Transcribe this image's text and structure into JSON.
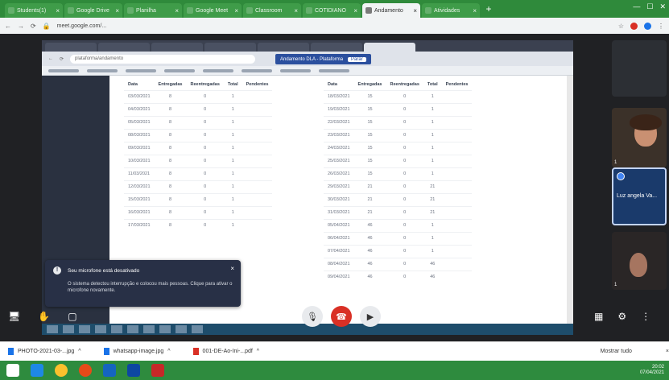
{
  "colors": {
    "chrome_green": "#2f8a3b",
    "meet_bg": "#202124",
    "end_call_red": "#d93025",
    "toast_bg": "#283046"
  },
  "outer_browser": {
    "tabs": [
      {
        "label": "Students(1)",
        "icon": "tab-favicon"
      },
      {
        "label": "Google Drive",
        "icon": "tab-favicon"
      },
      {
        "label": "Planilha",
        "icon": "tab-favicon"
      },
      {
        "label": "Google Meet",
        "icon": "tab-favicon"
      },
      {
        "label": "Classroom",
        "icon": "tab-favicon"
      },
      {
        "label": "COTIDIANO",
        "icon": "tab-favicon"
      },
      {
        "label": "Andamento",
        "icon": "tab-favicon",
        "active": true
      },
      {
        "label": "Atividades",
        "icon": "tab-favicon"
      }
    ],
    "url": "meet.google.com/..."
  },
  "shared_screen": {
    "share_banner": "Andamento DLA - Plataforma",
    "stop_label": "Parar",
    "url": "plataforma/andamento",
    "table_headers": [
      "Data",
      "Entregadas",
      "Reentregadas",
      "Total",
      "Pendentes"
    ],
    "table_left": [
      [
        "03/03/2021",
        "8",
        "0",
        "1",
        ""
      ],
      [
        "04/03/2021",
        "8",
        "0",
        "1",
        ""
      ],
      [
        "05/03/2021",
        "8",
        "0",
        "1",
        ""
      ],
      [
        "08/03/2021",
        "8",
        "0",
        "1",
        ""
      ],
      [
        "09/03/2021",
        "8",
        "0",
        "1",
        ""
      ],
      [
        "10/03/2021",
        "8",
        "0",
        "1",
        ""
      ],
      [
        "11/03/2021",
        "8",
        "0",
        "1",
        ""
      ],
      [
        "12/03/2021",
        "8",
        "0",
        "1",
        ""
      ],
      [
        "15/03/2021",
        "8",
        "0",
        "1",
        ""
      ],
      [
        "16/03/2021",
        "8",
        "0",
        "1",
        ""
      ],
      [
        "17/03/2021",
        "8",
        "0",
        "1",
        ""
      ]
    ],
    "table_right": [
      [
        "18/03/2021",
        "15",
        "0",
        "1",
        ""
      ],
      [
        "19/03/2021",
        "15",
        "0",
        "1",
        ""
      ],
      [
        "22/03/2021",
        "15",
        "0",
        "1",
        ""
      ],
      [
        "23/03/2021",
        "15",
        "0",
        "1",
        ""
      ],
      [
        "24/03/2021",
        "15",
        "0",
        "1",
        ""
      ],
      [
        "25/03/2021",
        "15",
        "0",
        "1",
        ""
      ],
      [
        "26/03/2021",
        "15",
        "0",
        "1",
        ""
      ],
      [
        "29/03/2021",
        "21",
        "0",
        "21",
        ""
      ],
      [
        "30/03/2021",
        "21",
        "0",
        "21",
        ""
      ],
      [
        "31/03/2021",
        "21",
        "0",
        "21",
        ""
      ],
      [
        "05/04/2021",
        "46",
        "0",
        "1",
        ""
      ],
      [
        "06/04/2021",
        "46",
        "0",
        "1",
        ""
      ],
      [
        "07/04/2021",
        "46",
        "0",
        "1",
        ""
      ],
      [
        "08/04/2021",
        "46",
        "0",
        "46",
        ""
      ],
      [
        "09/04/2021",
        "46",
        "0",
        "46",
        ""
      ]
    ]
  },
  "participants": [
    {
      "name": "",
      "role": "blank"
    },
    {
      "name": "",
      "role": "camera"
    },
    {
      "name": "Luz angela Va...",
      "role": "presenter"
    },
    {
      "name": "",
      "role": "camera"
    }
  ],
  "toast": {
    "title": "Seu microfone está desativado",
    "body": "O sistema detectou interrupção e colocou mais pessoas. Clique para ativar o microfone novamente."
  },
  "downloads": [
    {
      "label": "PHOTO-2021-03-...jpg",
      "icon": "image-file-icon"
    },
    {
      "label": "whatsapp-image.jpg",
      "icon": "image-file-icon"
    },
    {
      "label": "001-DE-Ao-Ini-...pdf",
      "icon": "pdf-file-icon"
    }
  ],
  "show_all_label": "Mostrar tudo",
  "clock": {
    "time": "20:02",
    "date": "07/04/2021"
  }
}
